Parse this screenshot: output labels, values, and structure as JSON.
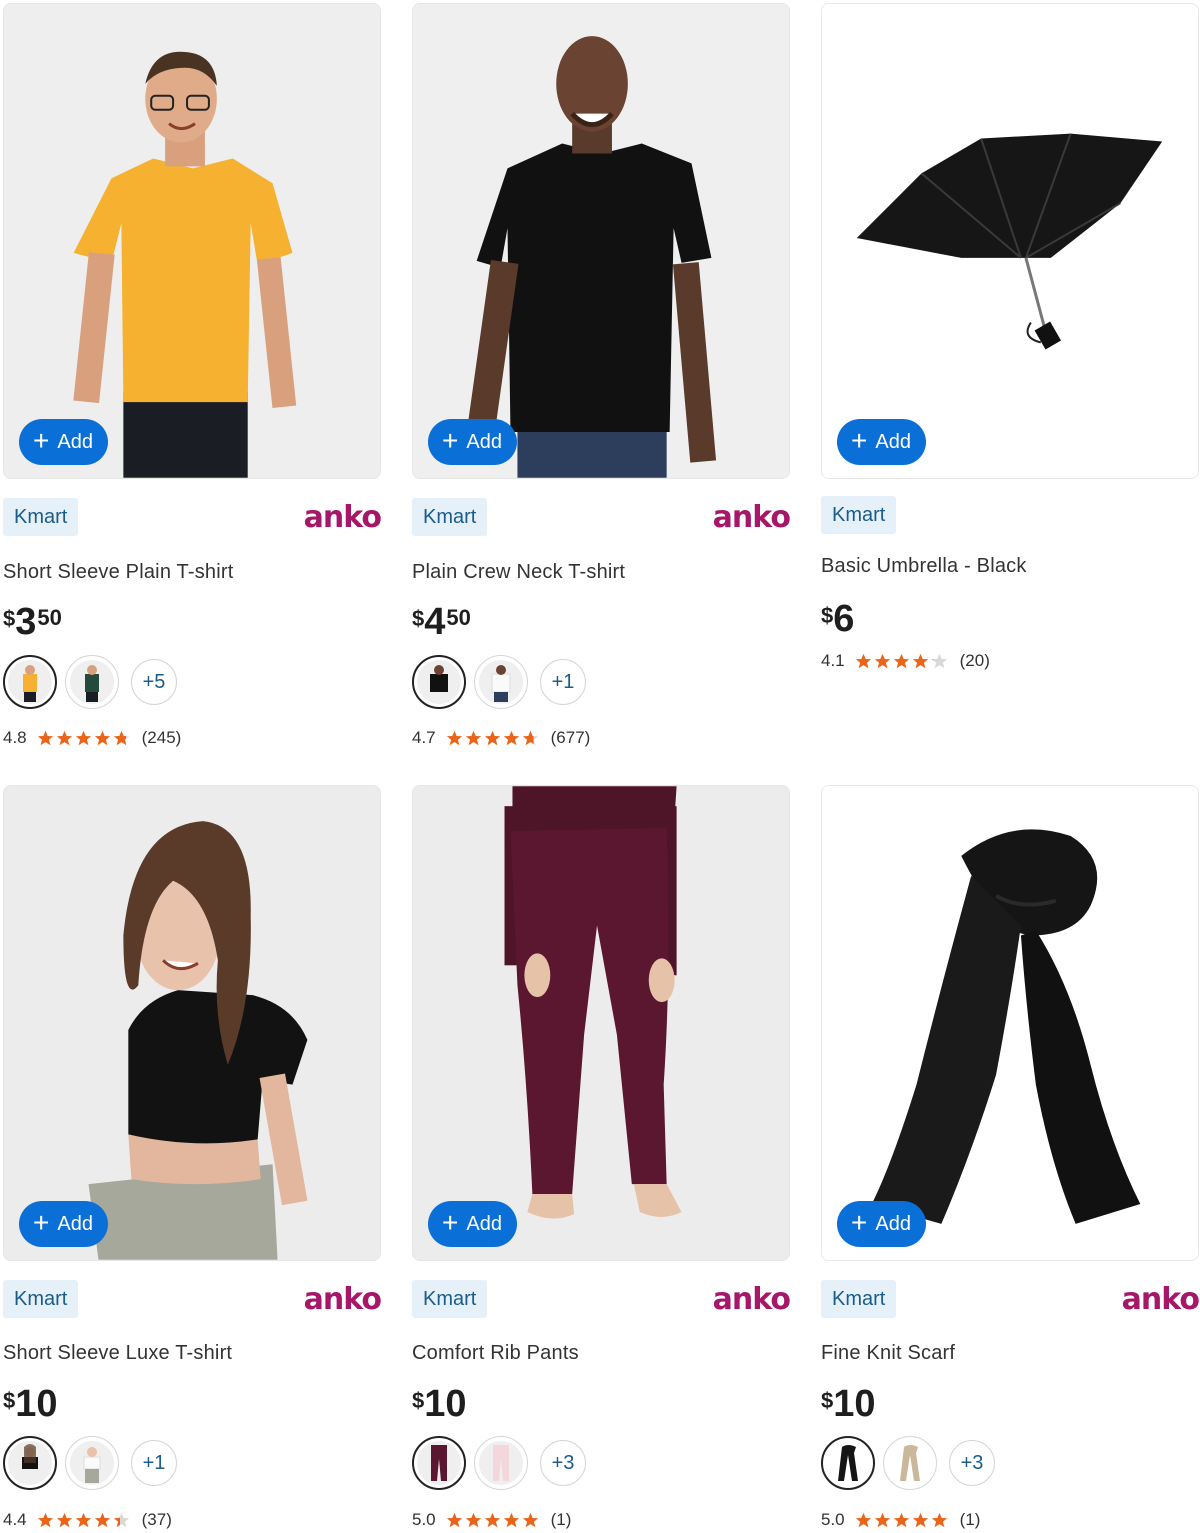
{
  "add_label": "Add",
  "products": [
    {
      "badge": "Kmart",
      "brand_logo": "anko",
      "title": "Short Sleeve Plain T-shirt",
      "price_currency": "$",
      "price_dollars": "3",
      "price_cents": "50",
      "more_swatches": "+5",
      "rating": "4.8",
      "stars": 4.8,
      "review_count": "(245)",
      "image": "boy-yellow-tshirt"
    },
    {
      "badge": "Kmart",
      "brand_logo": "anko",
      "title": "Plain Crew Neck T-shirt",
      "price_currency": "$",
      "price_dollars": "4",
      "price_cents": "50",
      "more_swatches": "+1",
      "rating": "4.7",
      "stars": 4.7,
      "review_count": "(677)",
      "image": "man-black-tshirt"
    },
    {
      "badge": "Kmart",
      "brand_logo": "",
      "title": "Basic Umbrella - Black",
      "price_currency": "$",
      "price_dollars": "6",
      "price_cents": "",
      "more_swatches": "",
      "rating": "4.1",
      "stars": 4.1,
      "review_count": "(20)",
      "image": "black-umbrella"
    },
    {
      "badge": "Kmart",
      "brand_logo": "anko",
      "title": "Short Sleeve Luxe T-shirt",
      "price_currency": "$",
      "price_dollars": "10",
      "price_cents": "",
      "more_swatches": "+1",
      "rating": "4.4",
      "stars": 4.4,
      "review_count": "(37)",
      "image": "woman-black-crop-tee"
    },
    {
      "badge": "Kmart",
      "brand_logo": "anko",
      "title": "Comfort Rib Pants",
      "price_currency": "$",
      "price_dollars": "10",
      "price_cents": "",
      "more_swatches": "+3",
      "rating": "5.0",
      "stars": 5.0,
      "review_count": "(1)",
      "image": "burgundy-rib-pants"
    },
    {
      "badge": "Kmart",
      "brand_logo": "anko",
      "title": "Fine Knit Scarf",
      "price_currency": "$",
      "price_dollars": "10",
      "price_cents": "",
      "more_swatches": "+3",
      "rating": "5.0",
      "stars": 5.0,
      "review_count": "(1)",
      "image": "black-knit-scarf"
    }
  ],
  "colors": {
    "add_button": "#0a6fd6",
    "badge_bg": "#e6f0f8",
    "badge_text": "#1a5c8a",
    "anko": "#a6176a",
    "star": "#e8651a"
  }
}
